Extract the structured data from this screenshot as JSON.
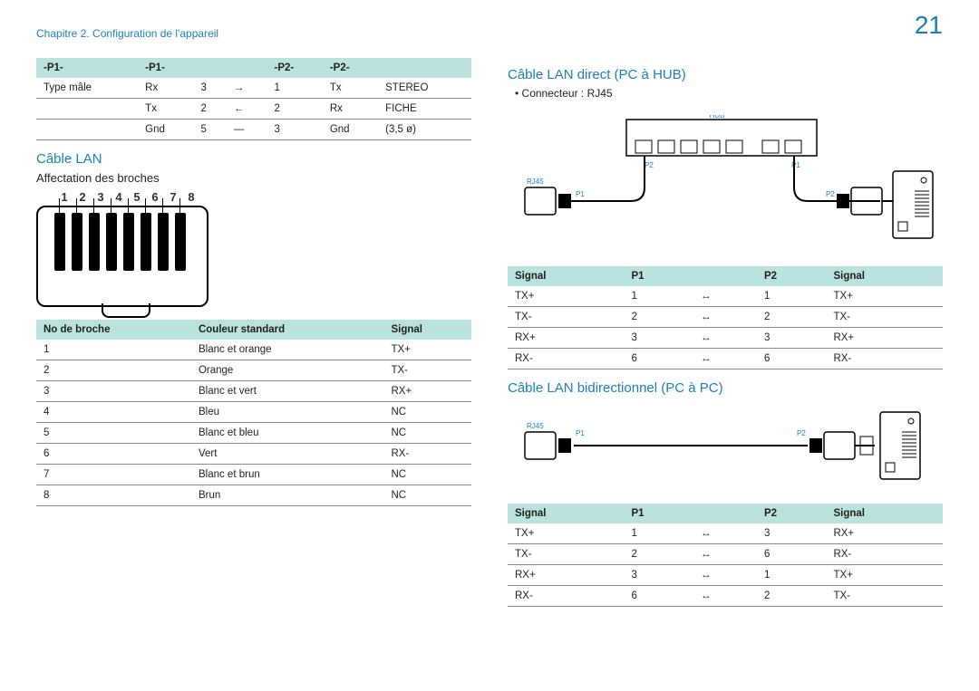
{
  "header": {
    "chapter": "Chapitre 2. Configuration de l'appareil",
    "page": "21"
  },
  "left": {
    "pin_table": {
      "headers": [
        "-P1-",
        "-P1-",
        "",
        "-P2-",
        "-P2-"
      ],
      "rows": [
        [
          "Type mâle",
          "Rx",
          "3",
          "→",
          "1",
          "Tx",
          "STEREO"
        ],
        [
          "",
          "Tx",
          "2",
          "←",
          "2",
          "Rx",
          "FICHE"
        ],
        [
          "",
          "Gnd",
          "5",
          "—",
          "3",
          "Gnd",
          "(3,5 ø)"
        ]
      ]
    },
    "section_lan": "Câble LAN",
    "subsection_pins": "Affectation des broches",
    "pin_numbers": [
      "1",
      "2",
      "3",
      "4",
      "5",
      "6",
      "7",
      "8"
    ],
    "color_table": {
      "headers": [
        "No de broche",
        "Couleur standard",
        "Signal"
      ],
      "rows": [
        [
          "1",
          "Blanc et orange",
          "TX+"
        ],
        [
          "2",
          "Orange",
          "TX-"
        ],
        [
          "3",
          "Blanc et vert",
          "RX+"
        ],
        [
          "4",
          "Bleu",
          "NC"
        ],
        [
          "5",
          "Blanc et bleu",
          "NC"
        ],
        [
          "6",
          "Vert",
          "RX-"
        ],
        [
          "7",
          "Blanc et brun",
          "NC"
        ],
        [
          "8",
          "Brun",
          "NC"
        ]
      ]
    }
  },
  "right": {
    "section_direct": "Câble LAN direct (PC à HUB)",
    "connector": "Connecteur : RJ45",
    "diagram_direct_labels": {
      "hub": "HUB",
      "rj45": "RJ45",
      "p1a": "P1",
      "p2a": "P2",
      "p1b": "P1",
      "p2b": "P2"
    },
    "direct_table": {
      "headers": [
        "Signal",
        "P1",
        "",
        "P2",
        "Signal"
      ],
      "rows": [
        [
          "TX+",
          "1",
          "↔",
          "1",
          "TX+"
        ],
        [
          "TX-",
          "2",
          "↔",
          "2",
          "TX-"
        ],
        [
          "RX+",
          "3",
          "↔",
          "3",
          "RX+"
        ],
        [
          "RX-",
          "6",
          "↔",
          "6",
          "RX-"
        ]
      ]
    },
    "section_cross": "Câble LAN bidirectionnel (PC à PC)",
    "diagram_cross_labels": {
      "rj45": "RJ45",
      "p1": "P1",
      "p2": "P2"
    },
    "cross_table": {
      "headers": [
        "Signal",
        "P1",
        "",
        "P2",
        "Signal"
      ],
      "rows": [
        [
          "TX+",
          "1",
          "↔",
          "3",
          "RX+"
        ],
        [
          "TX-",
          "2",
          "↔",
          "6",
          "RX-"
        ],
        [
          "RX+",
          "3",
          "↔",
          "1",
          "TX+"
        ],
        [
          "RX-",
          "6",
          "↔",
          "2",
          "TX-"
        ]
      ]
    }
  }
}
